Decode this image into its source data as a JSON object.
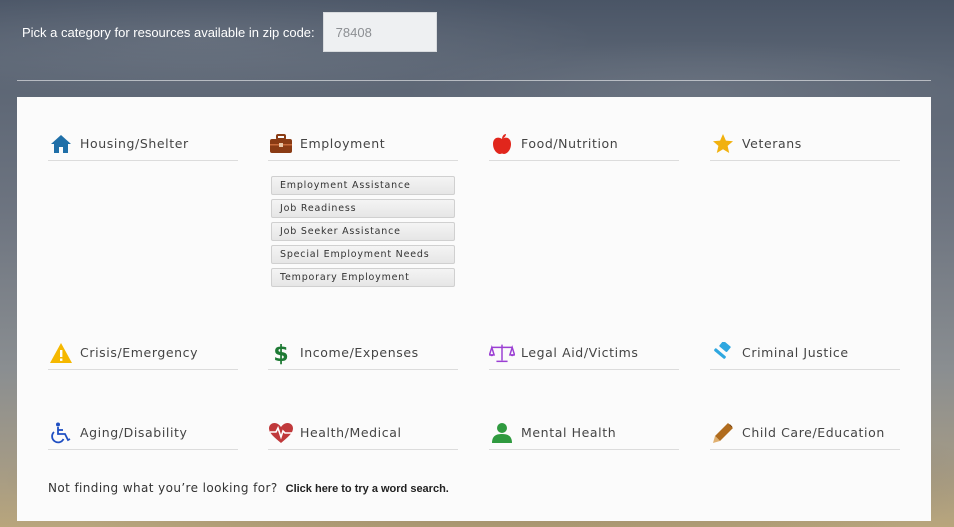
{
  "zip": {
    "label": "Pick a category for resources available in zip code:",
    "value": "78408"
  },
  "categories": [
    {
      "label": "Housing/Shelter",
      "icon": "home-icon",
      "color": "#1f6fa8"
    },
    {
      "label": "Employment",
      "icon": "briefcase-icon",
      "color": "#8a3b14"
    },
    {
      "label": "Food/Nutrition",
      "icon": "apple-icon",
      "color": "#e1261c"
    },
    {
      "label": "Veterans",
      "icon": "star-icon",
      "color": "#f1b10e"
    },
    {
      "label": "Crisis/Emergency",
      "icon": "warning-icon",
      "color": "#f5b800"
    },
    {
      "label": "Income/Expenses",
      "icon": "dollar-icon",
      "color": "#1e7a34"
    },
    {
      "label": "Legal Aid/Victims",
      "icon": "scales-icon",
      "color": "#9b3fd3"
    },
    {
      "label": "Criminal Justice",
      "icon": "gavel-icon",
      "color": "#2ea7e0"
    },
    {
      "label": "Aging/Disability",
      "icon": "wheelchair-icon",
      "color": "#1f4fc2"
    },
    {
      "label": "Health/Medical",
      "icon": "heartbeat-icon",
      "color": "#c0393b"
    },
    {
      "label": "Mental Health",
      "icon": "user-icon",
      "color": "#2f9a3f"
    },
    {
      "label": "Child Care/Education",
      "icon": "pencil-icon",
      "color": "#b06c1e"
    }
  ],
  "employment_subcategories": [
    "Employment Assistance",
    "Job Readiness",
    "Job Seeker Assistance",
    "Special Employment Needs",
    "Temporary Employment"
  ],
  "footer": {
    "question": "Not finding what you’re looking for?",
    "link": "Click here to try a word search."
  }
}
